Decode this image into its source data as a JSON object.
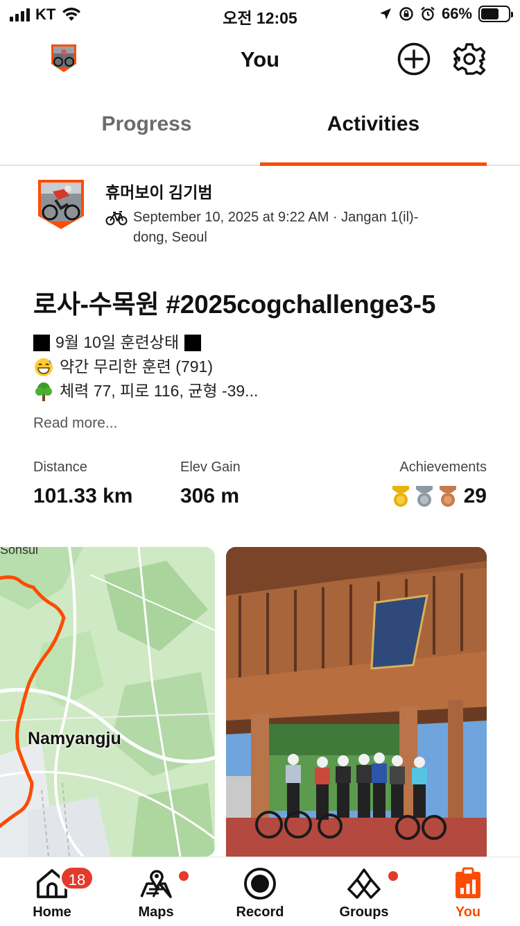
{
  "status_bar": {
    "carrier": "KT",
    "time": "오전 12:05",
    "battery_text": "66%",
    "battery_level": 0.66
  },
  "header": {
    "title": "You"
  },
  "tabs": [
    {
      "label": "Progress",
      "selected": false
    },
    {
      "label": "Activities",
      "selected": true
    }
  ],
  "activity": {
    "athlete_name": "휴머보이 김기범",
    "meta": "September 10, 2025 at 9:22 AM · Jangan 1(il)-dong, Seoul",
    "title": "로사-수목원  #2025cogchallenge3-5",
    "description": [
      "9월 10일 훈련상태",
      "약간 무리한 훈련 (791)",
      "체력 77, 피로 116, 균형 -39..."
    ],
    "read_more": "Read more...",
    "stats": {
      "distance_label": "Distance",
      "distance_value": "101.33 km",
      "elev_label": "Elev Gain",
      "elev_value": "306 m",
      "achievements_label": "Achievements",
      "achievements_count": "29"
    },
    "map": {
      "label": "Namyangju",
      "top_label": "Sohsul"
    }
  },
  "tab_bar": [
    {
      "label": "Home",
      "icon": "home-icon",
      "badge": "18",
      "active": false
    },
    {
      "label": "Maps",
      "icon": "maps-icon",
      "dot": true,
      "active": false
    },
    {
      "label": "Record",
      "icon": "record-icon",
      "active": false
    },
    {
      "label": "Groups",
      "icon": "groups-icon",
      "dot": true,
      "active": false
    },
    {
      "label": "You",
      "icon": "you-icon",
      "active": true
    }
  ],
  "colors": {
    "accent": "#fc4c02",
    "badge": "#e23b2e",
    "route": "#fc4c02",
    "medal_gold": "#e8b10c",
    "medal_silver": "#8e9aa0",
    "medal_bronze": "#c97a4a"
  }
}
